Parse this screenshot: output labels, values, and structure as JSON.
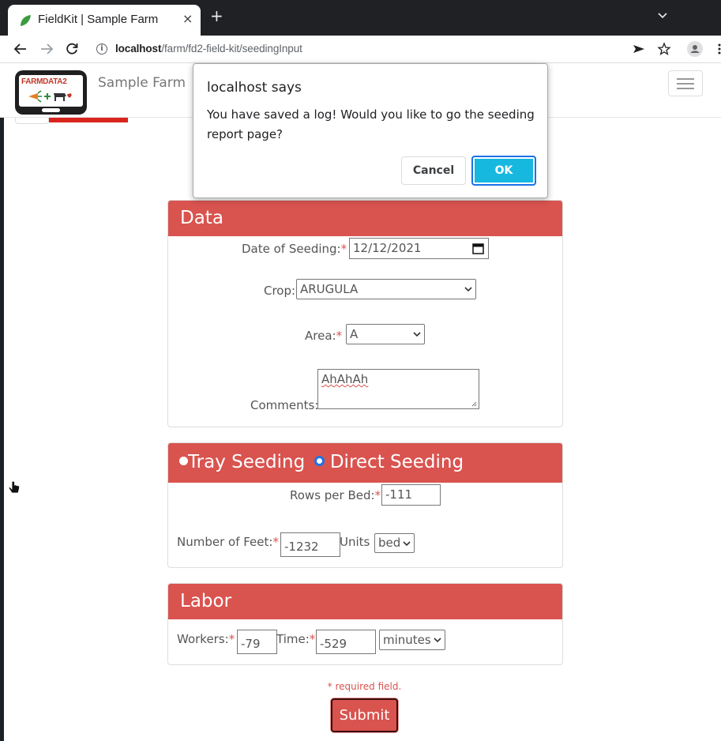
{
  "browser": {
    "tab_title": "FieldKit | Sample Farm",
    "tab_close": "×",
    "new_tab": "+",
    "url_host": "localhost",
    "url_path": "/farm/fd2-field-kit/seedingInput"
  },
  "nav": {
    "logo_text": "FARMDATA2",
    "brand": "Sample Farm"
  },
  "data_panel": {
    "title": "Data",
    "date_label": "Date of Seeding:",
    "date_value": "12/12/2021",
    "crop_label": "Crop:",
    "crop_value": "ARUGULA",
    "area_label": "Area:",
    "area_value": "A",
    "comments_label": "Comments:",
    "comments_value": "AhAhAh"
  },
  "seeding_panel": {
    "tray_label": "Tray Seeding",
    "direct_label": "Direct Seeding",
    "rows_label": "Rows per Bed:",
    "rows_value": "-111",
    "feet_label": "Number of Feet:",
    "feet_value": "-1232",
    "units_label": "Units",
    "units_value": "bed"
  },
  "labor_panel": {
    "title": "Labor",
    "workers_label": "Workers:",
    "workers_value": "-79",
    "time_label": "Time:",
    "time_value": "-529",
    "time_unit": "minutes"
  },
  "required_mark": "*",
  "required_note": "* required field.",
  "submit_label": "Submit",
  "dialog": {
    "title": "localhost says",
    "message": "You have saved a log! Would you like to go the seeding report page?",
    "cancel": "Cancel",
    "ok": "OK"
  },
  "colors": {
    "accent": "#d9534f",
    "ok_button": "#17b8e0",
    "browser_frame": "#202124"
  }
}
